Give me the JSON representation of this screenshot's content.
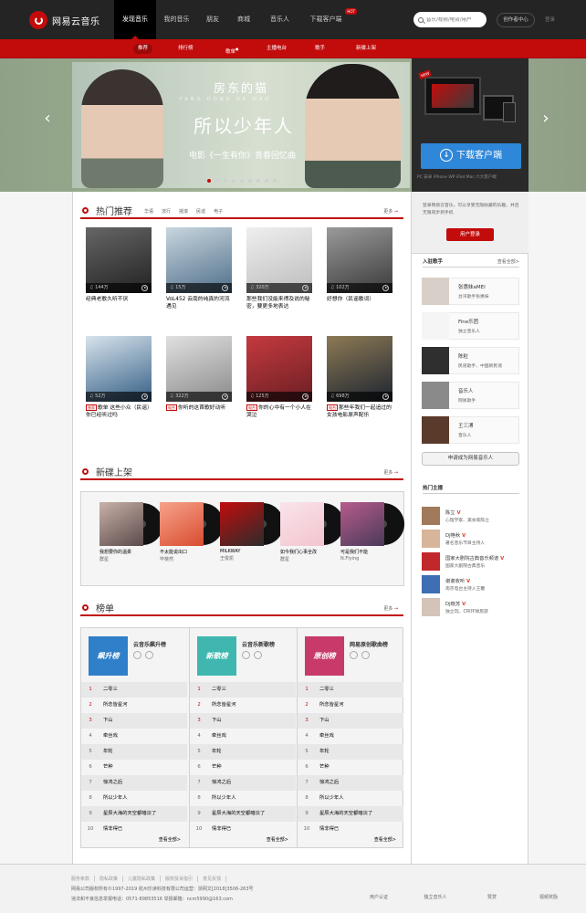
{
  "header": {
    "logo_text": "网易云音乐",
    "nav": [
      {
        "label": "发现音乐",
        "active": true
      },
      {
        "label": "我的音乐"
      },
      {
        "label": "朋友"
      },
      {
        "label": "商城"
      },
      {
        "label": "音乐人"
      },
      {
        "label": "下载客户端",
        "badge": "HOT"
      }
    ],
    "search_placeholder": "音乐/视频/电台/用户",
    "creator_label": "创作者中心",
    "login_label": "登录"
  },
  "subnav": [
    "推荐",
    "排行榜",
    "歌单",
    "主播电台",
    "歌手",
    "新碟上架"
  ],
  "subnav_sup": "●",
  "banner": {
    "title_cn": "房东的猫",
    "title_en": "FANG DONG DE MAO",
    "title_main": "所以少年人",
    "subtitle": "电影《一生有你》青春回忆曲",
    "download_label": "下载客户端",
    "download_note": "PC 安卓 iPhone WP iPad Mac 六大客户端",
    "new_badge": "NEW"
  },
  "hot": {
    "title": "热门推荐",
    "tags": [
      "华语",
      "流行",
      "摇滚",
      "民谣",
      "电子"
    ],
    "more": "更多",
    "playlists": [
      {
        "plays": "144万",
        "title": "经典老歌久听不厌",
        "color1": "#222",
        "color2": "#666"
      },
      {
        "plays": "15万",
        "title": "VoL452 云南的纯真的河流遇见",
        "color1": "#4f6f8b",
        "color2": "#c9d6de"
      },
      {
        "plays": "320万",
        "title": "那些我们没能来得及说的秘密，要更多地表达",
        "color1": "#bdbdbd",
        "color2": "#efefef"
      },
      {
        "plays": "102万",
        "title": "好想你（民谣歌词）",
        "color1": "#3a3a3a",
        "color2": "#9a9a9a"
      },
      {
        "plays": "52万",
        "title": "歌单 这些小众（民谣）你已经听过吗",
        "tag": "独家",
        "color1": "#355f86",
        "color2": "#d7e3ec"
      },
      {
        "plays": "322万",
        "title": "你听的这首歌好动听",
        "tag": "电台",
        "color1": "#8a8a8a",
        "color2": "#e0e0e0"
      },
      {
        "plays": "125万",
        "title": "你的心中有一个小人在哭泣",
        "tag": "电台",
        "color1": "#6b1f24",
        "color2": "#c43a3f"
      },
      {
        "plays": "698万",
        "title": "那些年我们一起追过的女孩电影原声配乐",
        "tag": "电台",
        "color1": "#1d2430",
        "color2": "#8d7a55"
      }
    ]
  },
  "new_album": {
    "title": "新碟上架",
    "more": "更多",
    "albums": [
      {
        "name": "我想要你的温柔",
        "artist": "群星",
        "color1": "#5a4a4a",
        "color2": "#c9b1a8"
      },
      {
        "name": "不太能说出口",
        "artist": "毕斐然",
        "color1": "#d94c2f",
        "color2": "#f6a38b"
      },
      {
        "name": "MILKWAY",
        "artist": "王俊凯",
        "color1": "#2c2c2c",
        "color2": "#c20c0c"
      },
      {
        "name": "如今我们心事全改",
        "artist": "群星",
        "color1": "#f3c4cf",
        "color2": "#f9e4ea"
      },
      {
        "name": "可是我们不能",
        "artist": "N.Flying",
        "color1": "#4a3a5a",
        "color2": "#b75c8c"
      }
    ]
  },
  "charts": {
    "title": "榜单",
    "more": "更多",
    "lists": [
      {
        "name": "云音乐飙升榜",
        "cover": "飙升榜",
        "color": "#2f7fc9",
        "songs": [
          "二零三",
          "所念皆星河",
          "下山",
          "牵丝戏",
          "年轮",
          "芒种",
          "惊鸿之后",
          "所以少年人",
          "星辰大海的天空都暗淡了",
          "情非得已"
        ]
      },
      {
        "name": "云音乐新歌榜",
        "cover": "新歌榜",
        "color": "#3fb7b0",
        "songs": [
          "二零三",
          "所念皆星河",
          "下山",
          "牵丝戏",
          "年轮",
          "芒种",
          "惊鸿之后",
          "所以少年人",
          "星辰大海的天空都暗淡了",
          "情非得已"
        ]
      },
      {
        "name": "网易原创歌曲榜",
        "cover": "原创榜",
        "color": "#c73a6a",
        "songs": [
          "二零三",
          "所念皆星河",
          "下山",
          "牵丝戏",
          "年轮",
          "芒种",
          "惊鸿之后",
          "所以少年人",
          "星辰大海的天空都暗淡了",
          "情非得已"
        ]
      }
    ],
    "view_all": "查看全部>"
  },
  "sidebar": {
    "login_text": "登录网易云音乐，可以享受无限收藏的乐趣，并且无限同步到手机",
    "login_btn": "用户登录",
    "singers_title": "入驻歌手",
    "singers_more": "查看全部>",
    "singers": [
      {
        "name": "张惠妹aMEI",
        "desc": "台湾歌手张惠妹",
        "color": "#d8d0c8"
      },
      {
        "name": "Fine乐团",
        "desc": "独立音乐人",
        "color": "#f5f5f5"
      },
      {
        "name": "陈粒",
        "desc": "民谣歌手、中国新民谣",
        "color": "#2f2f2f"
      },
      {
        "name": "音乐人",
        "desc": "网易歌手",
        "color": "#8a8a8a"
      },
      {
        "name": "王三溥",
        "desc": "音乐人",
        "color": "#5a3a2a"
      }
    ],
    "apply_btn": "申请成为网易音乐人",
    "dj_title": "热门主播",
    "djs": [
      {
        "name": "陈立",
        "desc": "心理学家、美食家陈立",
        "color": "#a07a5a"
      },
      {
        "name": "DJ艳秋",
        "desc": "著名音乐节目主持人",
        "color": "#d7b59a"
      },
      {
        "name": "国家大剧院古典音乐频道",
        "desc": "国家大剧院古典音乐",
        "color": "#c2272c"
      },
      {
        "name": "谢谢收听",
        "desc": "南京电台主持人王馨",
        "color": "#3d6fb2"
      },
      {
        "name": "DJ晓苏",
        "desc": "独立DJ，CRI环球旅游",
        "color": "#d4c3b8"
      }
    ]
  },
  "footer": {
    "links": [
      "服务条款",
      "隐私政策",
      "儿童隐私政策",
      "版权投诉指引",
      "意见反馈"
    ],
    "line1": "网易公司版权所有©1997-2019    杭州乐读科技有限公司运营：浙网文[2018]3506-263号",
    "line2": "违法和不良信息举报电话：0571-89853516    举报邮箱：ncm5990@163.com",
    "icons": [
      "用户认证",
      "独立音乐人",
      "赞赏",
      "视频奖励"
    ]
  }
}
